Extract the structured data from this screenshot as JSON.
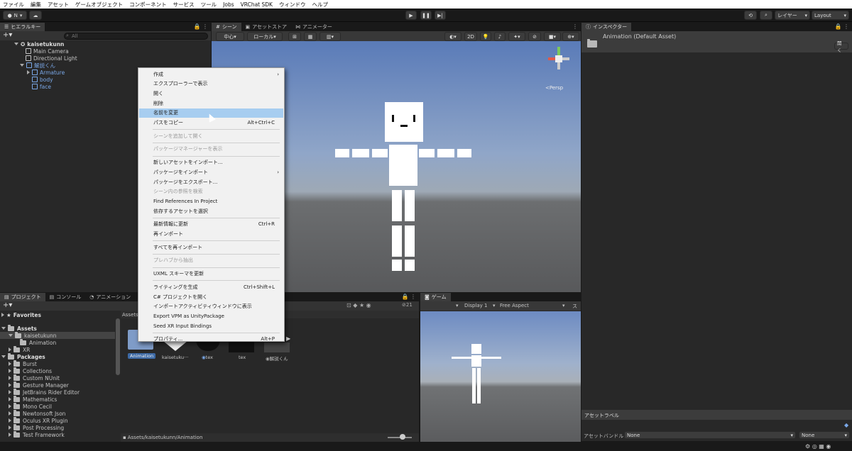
{
  "menubar": [
    "ファイル",
    "編集",
    "アセット",
    "ゲームオブジェクト",
    "コンポーネント",
    "サービス",
    "ツール",
    "Jobs",
    "VRChat SDK",
    "ウィンドウ",
    "ヘルプ"
  ],
  "toolbar": {
    "account": "N",
    "layer_label": "レイヤー",
    "layout_label": "Layout"
  },
  "hierarchy": {
    "tab": "ヒエラルキー",
    "search_placeholder": "All",
    "scene_name": "kaisetukunn",
    "items": [
      "Main Camera",
      "Directional Light",
      "解説くん",
      "Armature",
      "body",
      "face"
    ]
  },
  "scene_tabs": {
    "scene": "シーン",
    "store": "アセットストア",
    "animator": "アニメーター"
  },
  "scene_toolbar": {
    "pivot": "中心",
    "local": "ローカル",
    "mode2d": "2D",
    "persp": "<Persp"
  },
  "inspector": {
    "tab": "インスペクター",
    "title": "Animation (Default Asset)",
    "open_btn": "開く",
    "asset_label": "アセットラベル",
    "bundle_label": "アセットバンドル",
    "bundle_value": "None",
    "variant_value": "None"
  },
  "project": {
    "tabs": [
      "プロジェクト",
      "コンソール",
      "アニメーション"
    ],
    "favorites": "Favorites",
    "assets": "Assets",
    "assets_children": [
      "kaisetukunn",
      "Animation",
      "XR"
    ],
    "packages": "Packages",
    "packages_children": [
      "Burst",
      "Collections",
      "Custom NUnit",
      "Gesture Manager",
      "JetBrains Rider Editor",
      "Mathematics",
      "Mono Cecil",
      "Newtonsoft Json",
      "Oculus XR Plugin",
      "Post Processing",
      "Test Framework"
    ],
    "breadcrumb_top": "Assets",
    "path": "Assets/kaisetukunn/Animation",
    "count": "21",
    "assets_grid": [
      "Animation",
      "kaisetuku···",
      "tex",
      "tex",
      "解説くん"
    ]
  },
  "game": {
    "tab": "ゲーム",
    "display": "Display 1",
    "aspect": "Free Aspect",
    "scale": "ス"
  },
  "context_menu": [
    {
      "label": "作成",
      "sc": "",
      "sub": true,
      "dis": false
    },
    {
      "label": "エクスプローラーで表示",
      "sc": "",
      "sub": false,
      "dis": false
    },
    {
      "label": "開く",
      "sc": "",
      "sub": false,
      "dis": false
    },
    {
      "label": "削除",
      "sc": "",
      "sub": false,
      "dis": false
    },
    {
      "label": "名前を変更",
      "sc": "",
      "sub": false,
      "dis": false,
      "hl": true
    },
    {
      "label": "パスをコピー",
      "sc": "Alt+Ctrl+C",
      "sub": false,
      "dis": false
    },
    {
      "sep": true
    },
    {
      "label": "シーンを追加して開く",
      "sc": "",
      "sub": false,
      "dis": true
    },
    {
      "sep": true
    },
    {
      "label": "パッケージマネージャーを表示",
      "sc": "",
      "sub": false,
      "dis": true
    },
    {
      "sep": true
    },
    {
      "label": "新しいアセットをインポート...",
      "sc": "",
      "sub": false,
      "dis": false
    },
    {
      "label": "パッケージをインポート",
      "sc": "",
      "sub": true,
      "dis": false
    },
    {
      "label": "パッケージをエクスポート...",
      "sc": "",
      "sub": false,
      "dis": false
    },
    {
      "label": "シーン内の参照を検索",
      "sc": "",
      "sub": false,
      "dis": true
    },
    {
      "label": "Find References In Project",
      "sc": "",
      "sub": false,
      "dis": false
    },
    {
      "label": "依存するアセットを選択",
      "sc": "",
      "sub": false,
      "dis": false
    },
    {
      "sep": true
    },
    {
      "label": "最新情報に更新",
      "sc": "Ctrl+R",
      "sub": false,
      "dis": false
    },
    {
      "label": "再インポート",
      "sc": "",
      "sub": false,
      "dis": false
    },
    {
      "sep": true
    },
    {
      "label": "すべてを再インポート",
      "sc": "",
      "sub": false,
      "dis": false
    },
    {
      "sep": true
    },
    {
      "label": "プレハブから抽出",
      "sc": "",
      "sub": false,
      "dis": true
    },
    {
      "sep": true
    },
    {
      "label": "UXML スキーマを更新",
      "sc": "",
      "sub": false,
      "dis": false
    },
    {
      "sep": true
    },
    {
      "label": "ライティングを生成",
      "sc": "Ctrl+Shift+L",
      "sub": false,
      "dis": false
    },
    {
      "label": "C# プロジェクトを開く",
      "sc": "",
      "sub": false,
      "dis": false
    },
    {
      "label": "インポートアクティビティウィンドウに表示",
      "sc": "",
      "sub": false,
      "dis": false
    },
    {
      "label": "Export VPM as UnityPackage",
      "sc": "",
      "sub": false,
      "dis": false
    },
    {
      "label": "Seed XR Input Bindings",
      "sc": "",
      "sub": false,
      "dis": false
    },
    {
      "sep": true
    },
    {
      "label": "プロパティ...",
      "sc": "Alt+P",
      "sub": false,
      "dis": false
    }
  ],
  "colors": {
    "accent": "#7aa8e8",
    "highlight": "#a7cdf0",
    "panel": "#282828"
  }
}
